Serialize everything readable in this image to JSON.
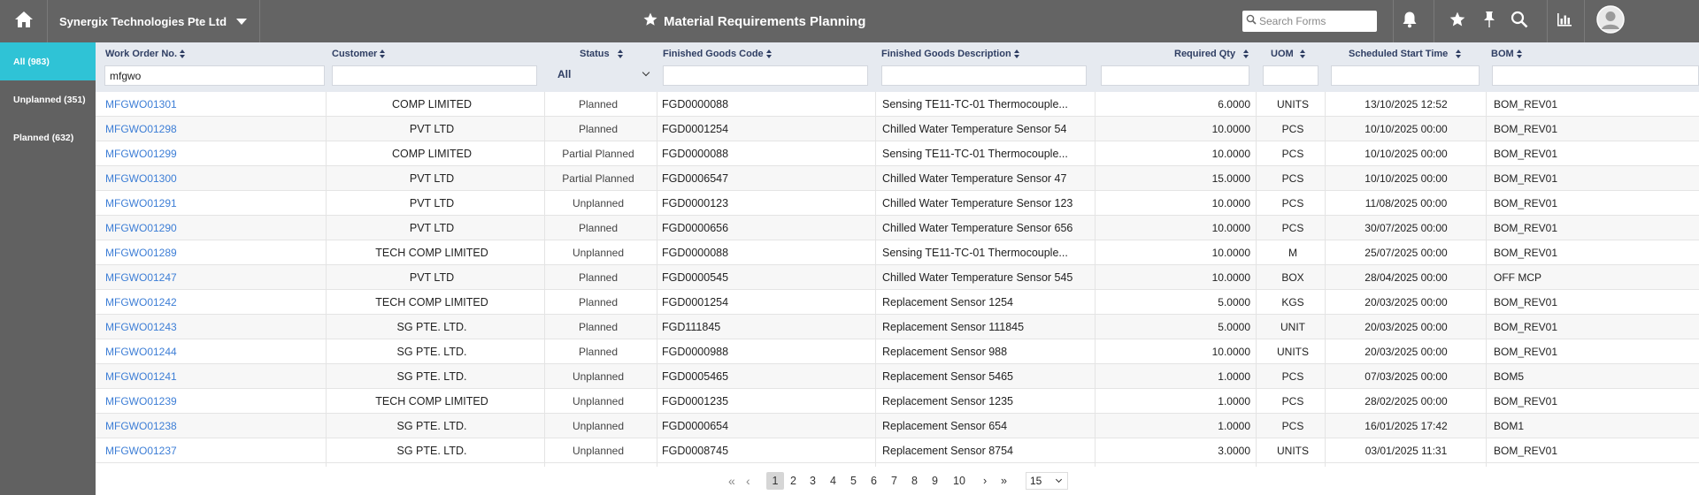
{
  "header": {
    "company": "Synergix Technologies Pte Ltd",
    "title": "Material Requirements Planning",
    "search_placeholder": "Search Forms",
    "icons": [
      "home-icon",
      "chevron-down-icon",
      "star-icon",
      "search-icon",
      "bell-icon",
      "star-icon",
      "pin-icon",
      "chart-icon",
      "user-avatar-icon"
    ]
  },
  "sidebar": {
    "items": [
      {
        "label": "All (983)",
        "active": true
      },
      {
        "label": "Unplanned (351)",
        "active": false
      },
      {
        "label": "Planned (632)",
        "active": false
      }
    ]
  },
  "columns": {
    "work_order": "Work Order No.",
    "customer": "Customer",
    "status": "Status",
    "fg_code": "Finished Goods Code",
    "fg_desc": "Finished Goods Description",
    "req_qty": "Required Qty",
    "uom": "UOM",
    "start_time": "Scheduled Start Time",
    "bom": "BOM"
  },
  "filters": {
    "work_order": "mfgwo",
    "status": "All"
  },
  "rows": [
    {
      "wo": "MFGWO01301",
      "cust": "COMP LIMITED",
      "status": "Planned",
      "code": "FGD0000088",
      "desc": "Sensing TE11-TC-01 Thermocouple...",
      "qty": "6.0000",
      "uom": "UNITS",
      "time": "13/10/2025 12:52",
      "bom": "BOM_REV01"
    },
    {
      "wo": "MFGWO01298",
      "cust": "PVT LTD",
      "status": "Planned",
      "code": "FGD0001254",
      "desc": "Chilled Water Temperature Sensor 54",
      "qty": "10.0000",
      "uom": "PCS",
      "time": "10/10/2025 00:00",
      "bom": "BOM_REV01"
    },
    {
      "wo": "MFGWO01299",
      "cust": "COMP LIMITED",
      "status": "Partial Planned",
      "code": "FGD0000088",
      "desc": "Sensing TE11-TC-01 Thermocouple...",
      "qty": "10.0000",
      "uom": "PCS",
      "time": "10/10/2025 00:00",
      "bom": "BOM_REV01"
    },
    {
      "wo": "MFGWO01300",
      "cust": "PVT LTD",
      "status": "Partial Planned",
      "code": "FGD0006547",
      "desc": "Chilled Water Temperature Sensor 47",
      "qty": "15.0000",
      "uom": "PCS",
      "time": "10/10/2025 00:00",
      "bom": "BOM_REV01"
    },
    {
      "wo": "MFGWO01291",
      "cust": "PVT LTD",
      "status": "Unplanned",
      "code": "FGD0000123",
      "desc": "Chilled Water Temperature Sensor 123",
      "qty": "10.0000",
      "uom": "PCS",
      "time": "11/08/2025 00:00",
      "bom": "BOM_REV01"
    },
    {
      "wo": "MFGWO01290",
      "cust": "PVT LTD",
      "status": "Planned",
      "code": "FGD0000656",
      "desc": "Chilled Water Temperature Sensor 656",
      "qty": "10.0000",
      "uom": "PCS",
      "time": "30/07/2025 00:00",
      "bom": "BOM_REV01"
    },
    {
      "wo": "MFGWO01289",
      "cust": "TECH COMP LIMITED",
      "status": "Unplanned",
      "code": "FGD0000088",
      "desc": "Sensing TE11-TC-01 Thermocouple...",
      "qty": "10.0000",
      "uom": "M",
      "time": "25/07/2025 00:00",
      "bom": "BOM_REV01"
    },
    {
      "wo": "MFGWO01247",
      "cust": "PVT LTD",
      "status": "Planned",
      "code": "FGD0000545",
      "desc": "Chilled Water Temperature Sensor 545",
      "qty": "10.0000",
      "uom": "BOX",
      "time": "28/04/2025 00:00",
      "bom": "OFF MCP"
    },
    {
      "wo": "MFGWO01242",
      "cust": "TECH COMP LIMITED",
      "status": "Planned",
      "code": "FGD0001254",
      "desc": "Replacement Sensor 1254",
      "qty": "5.0000",
      "uom": "KGS",
      "time": "20/03/2025 00:00",
      "bom": "BOM_REV01"
    },
    {
      "wo": "MFGWO01243",
      "cust": "SG PTE. LTD.",
      "status": "Planned",
      "code": "FGD111845",
      "desc": "Replacement Sensor 111845",
      "qty": "5.0000",
      "uom": "UNIT",
      "time": "20/03/2025 00:00",
      "bom": "BOM_REV01"
    },
    {
      "wo": "MFGWO01244",
      "cust": "SG PTE. LTD.",
      "status": "Planned",
      "code": "FGD0000988",
      "desc": "Replacement Sensor 988",
      "qty": "10.0000",
      "uom": "UNITS",
      "time": "20/03/2025 00:00",
      "bom": "BOM_REV01"
    },
    {
      "wo": "MFGWO01241",
      "cust": "SG PTE. LTD.",
      "status": "Unplanned",
      "code": "FGD0005465",
      "desc": "Replacement Sensor 5465",
      "qty": "1.0000",
      "uom": "PCS",
      "time": "07/03/2025 00:00",
      "bom": "BOM5"
    },
    {
      "wo": "MFGWO01239",
      "cust": "TECH COMP LIMITED",
      "status": "Unplanned",
      "code": "FGD0001235",
      "desc": "Replacement Sensor 1235",
      "qty": "1.0000",
      "uom": "PCS",
      "time": "28/02/2025 00:00",
      "bom": "BOM_REV01"
    },
    {
      "wo": "MFGWO01238",
      "cust": "SG PTE. LTD.",
      "status": "Unplanned",
      "code": "FGD0000654",
      "desc": "Replacement Sensor 654",
      "qty": "1.0000",
      "uom": "PCS",
      "time": "16/01/2025 17:42",
      "bom": "BOM1"
    },
    {
      "wo": "MFGWO01237",
      "cust": "SG PTE. LTD.",
      "status": "Unplanned",
      "code": "FGD0008745",
      "desc": "Replacement Sensor 8754",
      "qty": "3.0000",
      "uom": "UNITS",
      "time": "03/01/2025 11:31",
      "bom": "BOM_REV01"
    }
  ],
  "pager": {
    "pages": [
      "1",
      "2",
      "3",
      "4",
      "5",
      "6",
      "7",
      "8",
      "9",
      "10"
    ],
    "current": "1",
    "page_size": "15"
  }
}
